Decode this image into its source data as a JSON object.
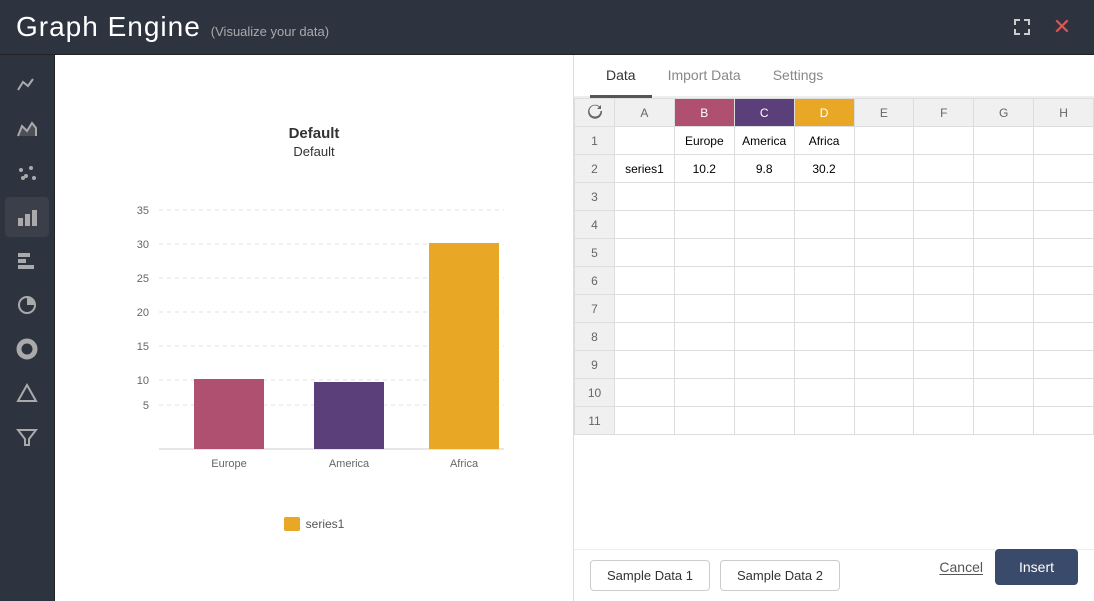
{
  "header": {
    "title": "Graph Engine",
    "subtitle": "(Visualize your data)",
    "fullscreen_label": "⛶",
    "close_label": "✕"
  },
  "sidebar": {
    "items": [
      {
        "id": "line",
        "icon": "〜",
        "label": "Line Chart"
      },
      {
        "id": "area",
        "icon": "∧",
        "label": "Area Chart"
      },
      {
        "id": "scatter",
        "icon": "⠿",
        "label": "Scatter Chart"
      },
      {
        "id": "bar-v",
        "icon": "▐",
        "label": "Bar Chart Vertical"
      },
      {
        "id": "bar-h",
        "icon": "▬",
        "label": "Bar Chart Horizontal"
      },
      {
        "id": "pie",
        "icon": "◕",
        "label": "Pie Chart"
      },
      {
        "id": "donut",
        "icon": "◎",
        "label": "Donut Chart"
      },
      {
        "id": "triangle",
        "icon": "▲",
        "label": "Triangle Chart"
      },
      {
        "id": "filter",
        "icon": "⧩",
        "label": "Filter"
      }
    ]
  },
  "chart": {
    "title": "Default",
    "subtitle": "Default",
    "bars": [
      {
        "label": "Europe",
        "value": 10.2,
        "color": "#b05070"
      },
      {
        "label": "America",
        "value": 9.8,
        "color": "#5b3f7a"
      },
      {
        "label": "Africa",
        "value": 30.2,
        "color": "#e8a825"
      }
    ],
    "y_max": 35,
    "y_ticks": [
      5,
      10,
      15,
      20,
      25,
      30,
      35
    ],
    "legend": [
      {
        "label": "series1",
        "color": "#e8a825"
      }
    ]
  },
  "tabs": [
    {
      "id": "data",
      "label": "Data",
      "active": true
    },
    {
      "id": "import",
      "label": "Import Data",
      "active": false
    },
    {
      "id": "settings",
      "label": "Settings",
      "active": false
    }
  ],
  "grid": {
    "col_headers": [
      "",
      "A",
      "B",
      "C",
      "D",
      "E",
      "F",
      "G",
      "H"
    ],
    "rows": [
      {
        "num": 1,
        "cells": [
          "",
          "Europe",
          "America",
          "Africa",
          "",
          "",
          "",
          ""
        ]
      },
      {
        "num": 2,
        "cells": [
          "series1",
          "10.2",
          "9.8",
          "30.2",
          "",
          "",
          "",
          ""
        ]
      },
      {
        "num": 3,
        "cells": [
          "",
          "",
          "",
          "",
          "",
          "",
          "",
          ""
        ]
      },
      {
        "num": 4,
        "cells": [
          "",
          "",
          "",
          "",
          "",
          "",
          "",
          ""
        ]
      },
      {
        "num": 5,
        "cells": [
          "",
          "",
          "",
          "",
          "",
          "",
          "",
          ""
        ]
      },
      {
        "num": 6,
        "cells": [
          "",
          "",
          "",
          "",
          "",
          "",
          "",
          ""
        ]
      },
      {
        "num": 7,
        "cells": [
          "",
          "",
          "",
          "",
          "",
          "",
          "",
          ""
        ]
      },
      {
        "num": 8,
        "cells": [
          "",
          "",
          "",
          "",
          "",
          "",
          "",
          ""
        ]
      },
      {
        "num": 9,
        "cells": [
          "",
          "",
          "",
          "",
          "",
          "",
          "",
          ""
        ]
      },
      {
        "num": 10,
        "cells": [
          "",
          "",
          "",
          "",
          "",
          "",
          "",
          ""
        ]
      },
      {
        "num": 11,
        "cells": [
          "",
          "",
          "",
          "",
          "",
          "",
          "",
          ""
        ]
      }
    ]
  },
  "buttons": {
    "sample_data_1": "Sample Data 1",
    "sample_data_2": "Sample Data 2",
    "cancel": "Cancel",
    "insert": "Insert"
  }
}
